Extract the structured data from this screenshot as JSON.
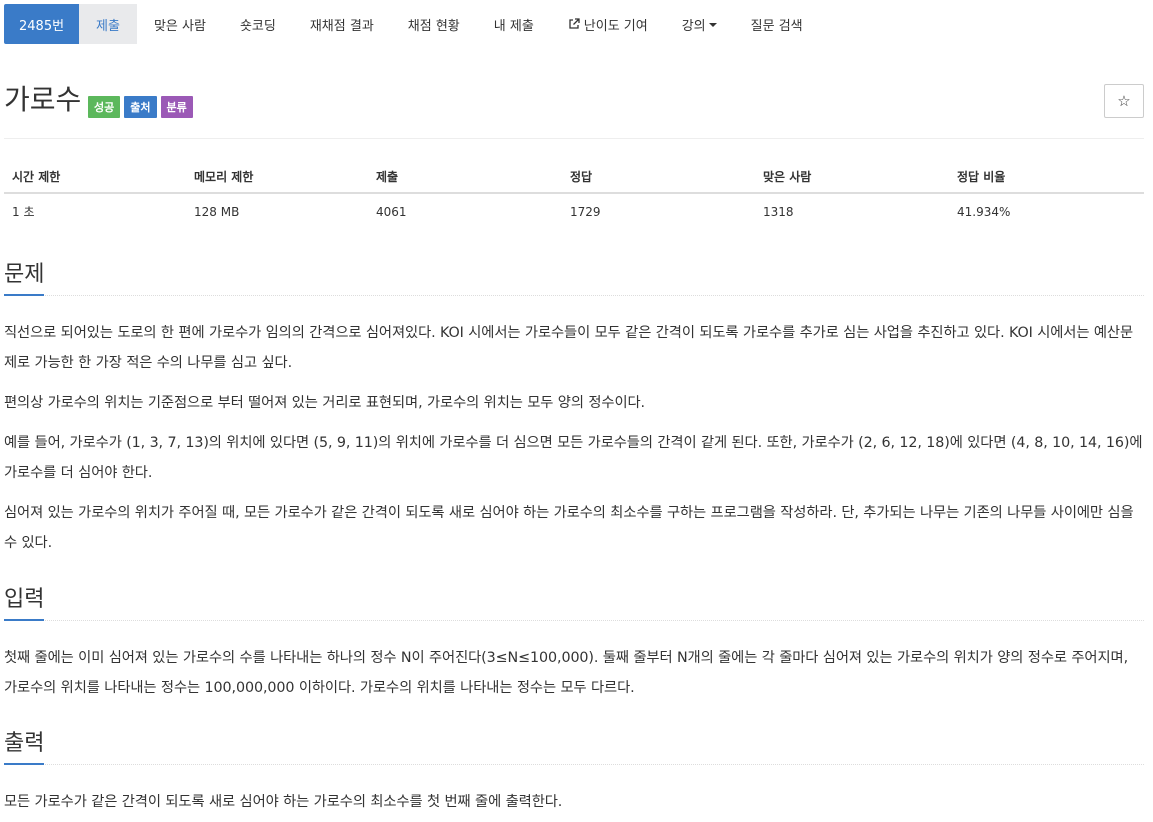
{
  "nav": {
    "problem_no": "2485번",
    "items": [
      "제출",
      "맞은 사람",
      "숏코딩",
      "재채점 결과",
      "채점 현황",
      "내 제출",
      "난이도 기여",
      "강의",
      "질문 검색"
    ]
  },
  "title": {
    "text": "가로수",
    "labels": {
      "success": "성공",
      "source": "출처",
      "category": "분류"
    },
    "star": "☆"
  },
  "info": {
    "headers": [
      "시간 제한",
      "메모리 제한",
      "제출",
      "정답",
      "맞은 사람",
      "정답 비율"
    ],
    "values": [
      "1 초",
      "128 MB",
      "4061",
      "1729",
      "1318",
      "41.934%"
    ]
  },
  "problem": {
    "heading": "문제",
    "paragraphs": [
      "직선으로 되어있는 도로의 한 편에 가로수가 임의의 간격으로 심어져있다. KOI 시에서는 가로수들이 모두 같은 간격이 되도록 가로수를 추가로 심는 사업을 추진하고 있다. KOI 시에서는 예산문제로 가능한 한 가장 적은 수의 나무를 심고 싶다.",
      "편의상 가로수의 위치는 기준점으로 부터 떨어져 있는 거리로 표현되며, 가로수의 위치는 모두 양의 정수이다.",
      "예를 들어, 가로수가 (1, 3, 7, 13)의 위치에 있다면 (5, 9, 11)의 위치에 가로수를 더 심으면 모든 가로수들의 간격이 같게 된다. 또한, 가로수가 (2, 6, 12, 18)에 있다면 (4, 8, 10, 14, 16)에 가로수를 더 심어야 한다.",
      "심어져 있는 가로수의 위치가 주어질 때, 모든 가로수가 같은 간격이 되도록 새로 심어야 하는 가로수의 최소수를 구하는 프로그램을 작성하라. 단, 추가되는 나무는 기존의 나무들 사이에만 심을 수 있다."
    ]
  },
  "input": {
    "heading": "입력",
    "paragraphs": [
      "첫째 줄에는 이미 심어져 있는 가로수의 수를 나타내는 하나의 정수 N이 주어진다(3≤N≤100,000). 둘째 줄부터 N개의 줄에는 각 줄마다 심어져 있는 가로수의 위치가 양의 정수로 주어지며, 가로수의 위치를 나타내는 정수는 100,000,000 이하이다. 가로수의 위치를 나타내는 정수는 모두 다르다."
    ]
  },
  "output": {
    "heading": "출력",
    "paragraphs": [
      "모든 가로수가 같은 간격이 되도록 새로 심어야 하는 가로수의 최소수를 첫 번째 줄에 출력한다."
    ]
  },
  "colors": {
    "primary": "#3a7bc8",
    "success": "#5cb85c",
    "category": "#9b59b6"
  }
}
